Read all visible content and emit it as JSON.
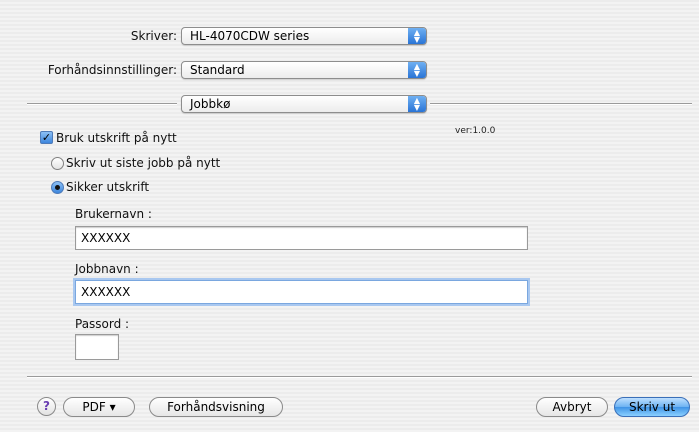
{
  "printer": {
    "label": "Skriver:",
    "value": "HL-4070CDW series"
  },
  "presets": {
    "label": "Forhåndsinnstillinger:",
    "value": "Standard"
  },
  "panel": {
    "value": "Jobbkø"
  },
  "version": "ver:1.0.0",
  "reprint": {
    "label": "Bruk utskrift på nytt",
    "checked": true
  },
  "options": [
    {
      "label": "Skriv ut siste jobb på nytt",
      "selected": false
    },
    {
      "label": "Sikker utskrift",
      "selected": true
    }
  ],
  "username": {
    "label": "Brukernavn :",
    "value": "XXXXXX"
  },
  "jobname": {
    "label": "Jobbnavn :",
    "value": "XXXXXX"
  },
  "password": {
    "label": "Passord :",
    "value": ""
  },
  "footer": {
    "help": "?",
    "pdf": "PDF ▾",
    "preview": "Forhåndsvisning",
    "cancel": "Avbryt",
    "print": "Skriv ut"
  }
}
